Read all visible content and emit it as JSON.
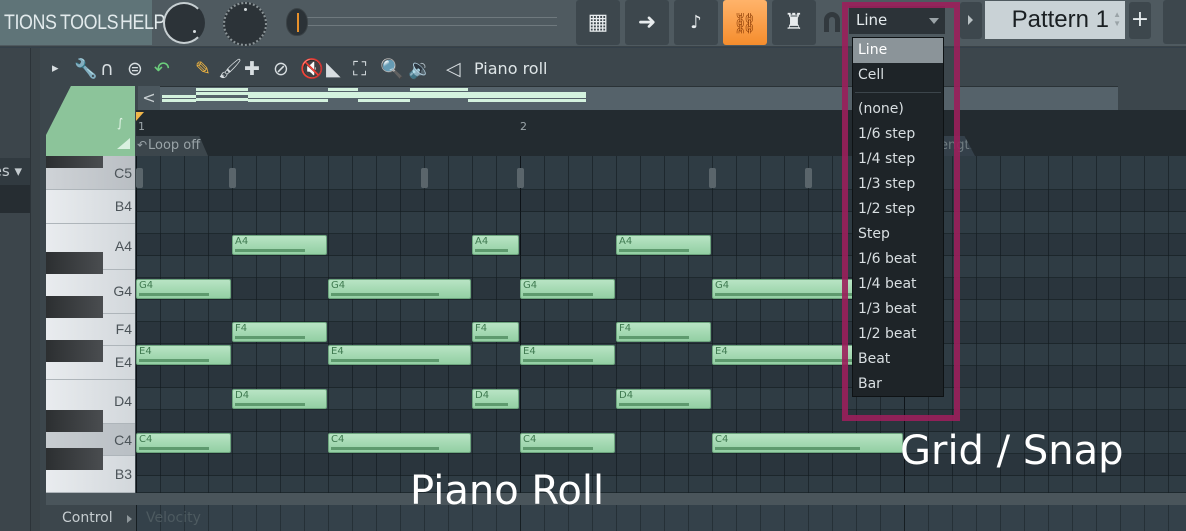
{
  "topbar": {
    "menu_items": [
      "TIONS",
      "TOOLS",
      "HELP"
    ],
    "snap_value": "Line",
    "pattern_name": "Pattern 1",
    "pattern_spin": "▲▼",
    "add_pattern": "+",
    "buttons": [
      {
        "name": "piano-roll-view-icon",
        "glyph": "▦"
      },
      {
        "name": "arrow-right-icon",
        "glyph": "➜"
      },
      {
        "name": "note-slide-icon",
        "glyph": "♪"
      },
      {
        "name": "link-icon",
        "glyph": "🔗",
        "active": true
      },
      {
        "name": "knob-stamp-icon",
        "glyph": "♜"
      }
    ]
  },
  "browser": {
    "tab_label": "es ▾"
  },
  "piano_roll": {
    "title": "Piano roll",
    "tools": [
      {
        "name": "menu-arrow-icon",
        "glyph": "▸"
      },
      {
        "name": "wrench-icon",
        "glyph": "🔧"
      },
      {
        "name": "magnet-icon",
        "glyph": "∩"
      },
      {
        "name": "list-menu-icon",
        "glyph": "⊜"
      },
      {
        "name": "undo-icon",
        "glyph": "↶"
      },
      {
        "name": "pencil-icon",
        "glyph": "✎"
      },
      {
        "name": "paint-brush-icon",
        "glyph": "🖌"
      },
      {
        "name": "paint-add-icon",
        "glyph": "✚"
      },
      {
        "name": "delete-icon",
        "glyph": "⊘"
      },
      {
        "name": "mute-icon",
        "glyph": "🔇"
      },
      {
        "name": "slice-icon",
        "glyph": "◣"
      },
      {
        "name": "select-icon",
        "glyph": "⛶"
      },
      {
        "name": "zoom-icon",
        "glyph": "🔍"
      },
      {
        "name": "playback-icon",
        "glyph": "🔉"
      },
      {
        "name": "speaker-icon",
        "glyph": "◁"
      }
    ],
    "overview_back": "<",
    "timeline": {
      "bars": [
        "1",
        "2"
      ],
      "loop_label": "Loop off",
      "length_label": "Length"
    },
    "keys": [
      {
        "label": "C5",
        "highlight": true
      },
      {
        "label": "B4"
      },
      {
        "label": "A4"
      },
      {
        "label": "G4"
      },
      {
        "label": "F4"
      },
      {
        "label": "E4"
      },
      {
        "label": "D4"
      },
      {
        "label": "C4",
        "highlight": true
      },
      {
        "label": "B3"
      }
    ],
    "notes": [
      {
        "pitch": "G4",
        "start_step": 0,
        "length_steps": 4
      },
      {
        "pitch": "G4",
        "start_step": 8,
        "length_steps": 6
      },
      {
        "pitch": "G4",
        "start_step": 16,
        "length_steps": 4
      },
      {
        "pitch": "G4",
        "start_step": 24,
        "length_steps": 8
      },
      {
        "pitch": "A4",
        "start_step": 4,
        "length_steps": 4
      },
      {
        "pitch": "A4",
        "start_step": 14,
        "length_steps": 2
      },
      {
        "pitch": "A4",
        "start_step": 20,
        "length_steps": 4
      },
      {
        "pitch": "F4",
        "start_step": 4,
        "length_steps": 4
      },
      {
        "pitch": "F4",
        "start_step": 14,
        "length_steps": 2
      },
      {
        "pitch": "F4",
        "start_step": 20,
        "length_steps": 4
      },
      {
        "pitch": "E4",
        "start_step": 0,
        "length_steps": 4
      },
      {
        "pitch": "E4",
        "start_step": 8,
        "length_steps": 6
      },
      {
        "pitch": "E4",
        "start_step": 16,
        "length_steps": 4
      },
      {
        "pitch": "E4",
        "start_step": 24,
        "length_steps": 8
      },
      {
        "pitch": "D4",
        "start_step": 4,
        "length_steps": 4
      },
      {
        "pitch": "D4",
        "start_step": 14,
        "length_steps": 2
      },
      {
        "pitch": "D4",
        "start_step": 20,
        "length_steps": 4
      },
      {
        "pitch": "C4",
        "start_step": 0,
        "length_steps": 4
      },
      {
        "pitch": "C4",
        "start_step": 8,
        "length_steps": 6
      },
      {
        "pitch": "C4",
        "start_step": 16,
        "length_steps": 4
      },
      {
        "pitch": "C4",
        "start_step": 24,
        "length_steps": 8
      }
    ],
    "note_velocity": 0.78,
    "control_label": "Control",
    "control_target": "Velocity"
  },
  "snap_dropdown": {
    "selected": "Line",
    "items_top": [
      "Line",
      "Cell"
    ],
    "items": [
      "(none)",
      "1/6 step",
      "1/4 step",
      "1/3 step",
      "1/2 step",
      "Step",
      "1/6 beat",
      "1/4 beat",
      "1/3 beat",
      "1/2 beat",
      "Beat",
      "Bar"
    ]
  },
  "annotations": {
    "piano_roll": "Piano Roll",
    "grid_snap": "Grid / Snap"
  },
  "colors": {
    "note_fill": "#a8dbb5",
    "highlight_box": "#9a1f5b",
    "active_button": "#f79a3e"
  }
}
